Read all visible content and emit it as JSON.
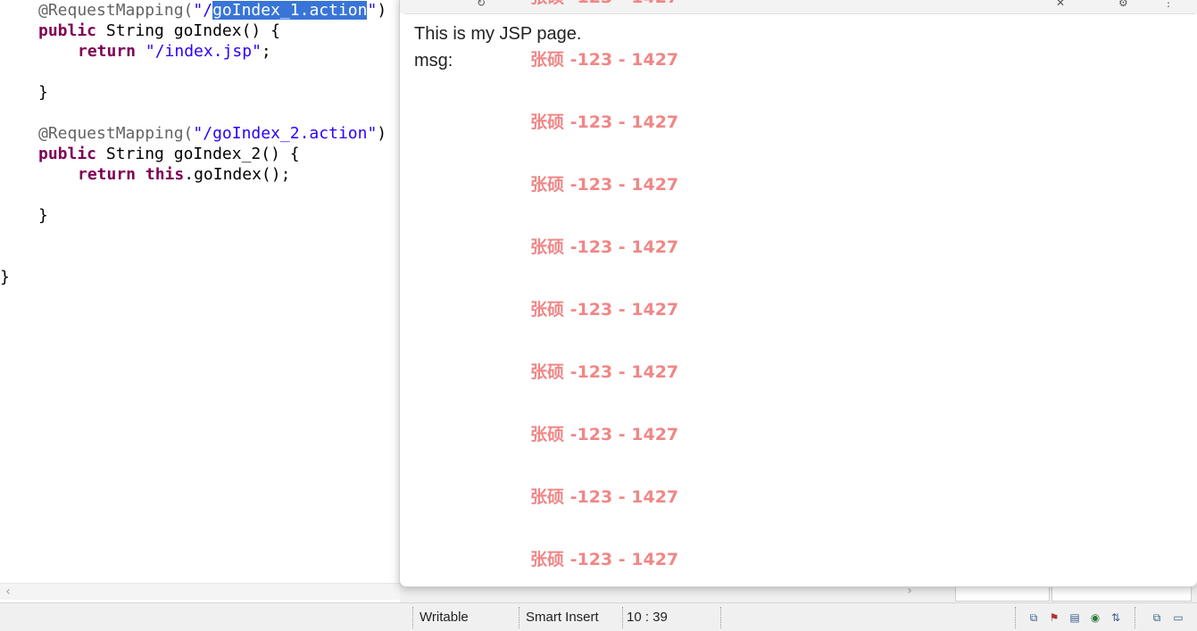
{
  "editor": {
    "lines": [
      {
        "annotation": "@RequestMapping(",
        "q1": "\"/",
        "selected": "goIndex_1.action",
        "q2": "\"",
        "close": ")"
      },
      {
        "kw": "public",
        "rest": " String goIndex() {"
      },
      {
        "kw": "return",
        "str": "\"/index.jsp\"",
        "rest": ";"
      },
      {
        "text": "}"
      },
      {
        "annotation": "@RequestMapping(",
        "str": "\"/goIndex_2.action\"",
        "close": ")"
      },
      {
        "kw": "public",
        "rest": " String goIndex_2() {"
      },
      {
        "kw": "return",
        "kw2": "this",
        "rest": ".goIndex();"
      },
      {
        "text": "}"
      },
      {
        "text": "}"
      }
    ]
  },
  "browser": {
    "page_title": "This is my JSP page.",
    "msg_label": "msg:",
    "watermark_text": "张硕 -123 - 1427",
    "watermark_count": 10,
    "watermark_color": "#f07a7a"
  },
  "statusbar": {
    "writable": "Writable",
    "insert_mode": "Smart Insert",
    "position": "10 : 39",
    "tray_icons": [
      "restore-icon",
      "java-ee-icon",
      "outline-icon",
      "web-browser-icon",
      "sync-icon",
      "restore-icon",
      "console-icon"
    ]
  },
  "colors": {
    "keyword": "#7f0055",
    "string": "#2a00ff",
    "annotation": "#646464",
    "selection": "#3875d7"
  }
}
